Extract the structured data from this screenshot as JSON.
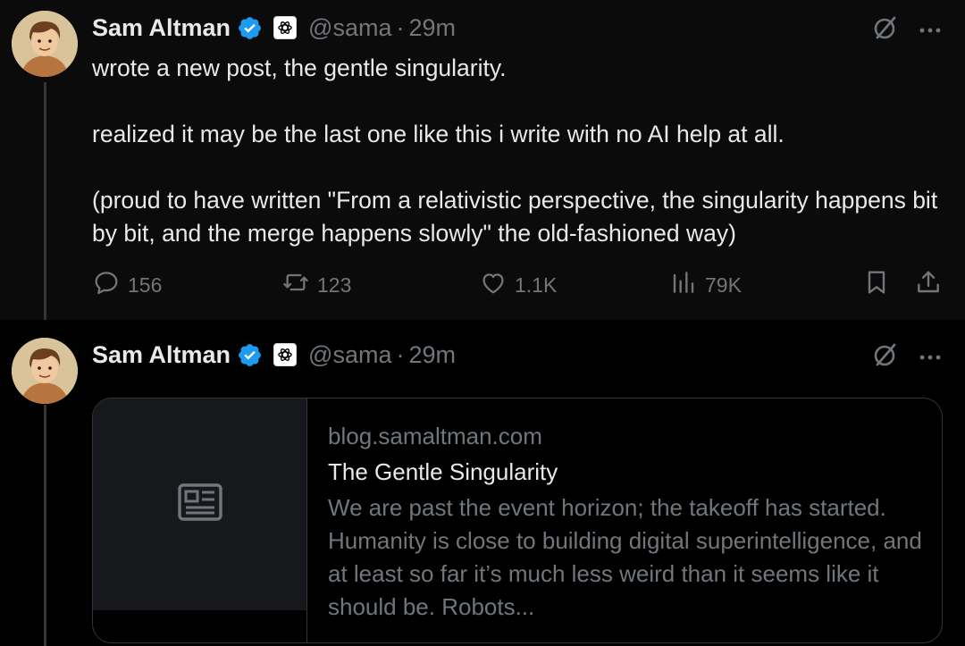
{
  "posts": [
    {
      "author": {
        "name": "Sam Altman",
        "handle": "@sama",
        "separator": "·",
        "time": "29m",
        "avatar": "avatar-cartoon-portrait",
        "verified_color": "#1d9bf0",
        "org_badge": "openai-logo"
      },
      "text": [
        "wrote a new post, the gentle singularity.",
        "realized it may be the last one like this i write with no AI help at all.",
        "(proud to have written \"From a relativistic perspective, the singularity happens bit by bit, and the merge happens slowly\" the old-fashioned way)"
      ],
      "actions": {
        "replies": "156",
        "reposts": "123",
        "likes": "1.1K",
        "views": "79K"
      }
    },
    {
      "author": {
        "name": "Sam Altman",
        "handle": "@sama",
        "separator": "·",
        "time": "29m",
        "avatar": "avatar-cartoon-portrait",
        "verified_color": "#1d9bf0",
        "org_badge": "openai-logo"
      },
      "link_card": {
        "domain": "blog.samaltman.com",
        "title": "The Gentle Singularity",
        "description": "We are past the event horizon; the takeoff has started. Humanity is close to building digital superintelligence, and at least so far it’s much less weird than it seems like it should be. Robots...",
        "thumbnail_icon": "article-icon"
      }
    }
  ],
  "icons": {
    "grok": "grok-icon",
    "more": "more-icon",
    "reply": "reply-icon",
    "repost": "repost-icon",
    "like": "like-icon",
    "views": "views-icon",
    "bookmark": "bookmark-icon",
    "share": "share-icon"
  },
  "colors": {
    "background": "#000000",
    "text": "#e7e9ea",
    "muted": "#71767b",
    "border": "#333639",
    "verified": "#1d9bf0"
  }
}
